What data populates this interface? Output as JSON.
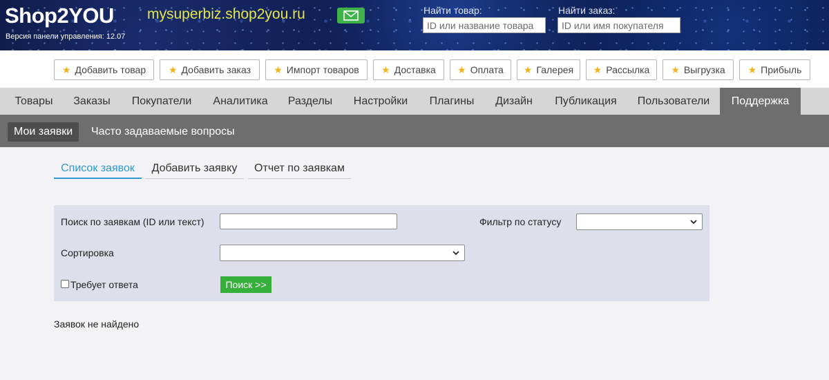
{
  "header": {
    "logo": "Shop2YOU",
    "version_text": "Версия панели управления: 12.07",
    "domain": "mysuperbiz.shop2you.ru",
    "mail_icon": "envelope-icon",
    "find_product": {
      "label": "Найти товар:",
      "placeholder": "ID или название товара",
      "value": ""
    },
    "find_order": {
      "label": "Найти заказ:",
      "placeholder": "ID или имя покупателя",
      "value": ""
    }
  },
  "quick_buttons": [
    {
      "label": "Добавить товар",
      "icon": "star-icon"
    },
    {
      "label": "Добавить заказ",
      "icon": "star-icon"
    },
    {
      "label": "Импорт товаров",
      "icon": "star-icon"
    },
    {
      "label": "Доставка",
      "icon": "star-icon"
    },
    {
      "label": "Оплата",
      "icon": "star-icon"
    },
    {
      "label": "Галерея",
      "icon": "star-icon"
    },
    {
      "label": "Рассылка",
      "icon": "star-icon"
    },
    {
      "label": "Выгрузка",
      "icon": "star-icon"
    },
    {
      "label": "Прибыль",
      "icon": "star-icon"
    }
  ],
  "main_nav": [
    {
      "label": "Товары"
    },
    {
      "label": "Заказы"
    },
    {
      "label": "Покупатели"
    },
    {
      "label": "Аналитика"
    },
    {
      "label": "Разделы"
    },
    {
      "label": "Настройки"
    },
    {
      "label": "Плагины"
    },
    {
      "label": "Дизайн"
    },
    {
      "label": "Публикация"
    },
    {
      "label": "Пользователи"
    },
    {
      "label": "Поддержка",
      "active": true
    }
  ],
  "sub_nav": [
    {
      "label": "Мои заявки",
      "active": true
    },
    {
      "label": "Часто задаваемые вопросы"
    }
  ],
  "tabs": [
    {
      "label": "Список заявок",
      "active": true
    },
    {
      "label": "Добавить заявку"
    },
    {
      "label": "Отчет по заявкам"
    }
  ],
  "filter": {
    "search_label": "Поиск по заявкам (ID или текст)",
    "search_value": "",
    "status_label": "Фильтр по статусу",
    "status_value": "",
    "sort_label": "Сортировка",
    "sort_value": "",
    "needs_reply_label": "Требует ответа",
    "needs_reply_checked": false,
    "search_button": "Поиск >>"
  },
  "empty_message": "Заявок не найдено",
  "colors": {
    "accent_tab": "#2e9ad0",
    "search_button": "#35b03a",
    "mail_button": "#3fb24a",
    "domain_text": "#e6e64a",
    "star": "#f2b21c"
  }
}
